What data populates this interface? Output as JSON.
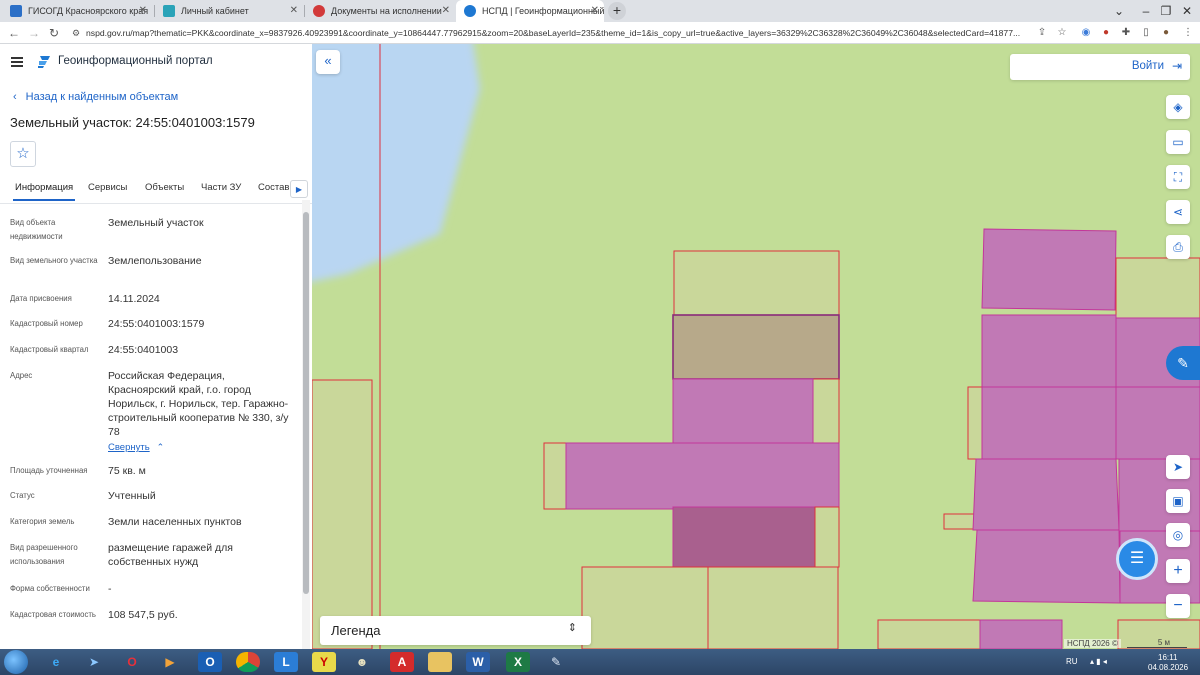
{
  "browser": {
    "tabs": [
      {
        "title": "ГИСОГД Красноярского края",
        "icon": "gisogd-favicon",
        "color": "#2b6fc7"
      },
      {
        "title": "Личный кабинет",
        "icon": "lk-favicon",
        "color": "#2aa3b8"
      },
      {
        "title": "Документы на исполнении",
        "icon": "docs-favicon",
        "color": "#d23a3a"
      },
      {
        "title": "НСПД | Геоинформационный п",
        "icon": "nspd-favicon",
        "color": "#1e78d2"
      }
    ],
    "new_tab_label": "+",
    "url": "nspd.gov.ru/map?thematic=PKK&coordinate_x=9837926.40923991&coordinate_y=10864447.77962915&zoom=20&baseLayerId=235&theme_id=1&is_copy_url=true&active_layers=36329%2C36328%2C36049%2C36048&selectedCard=41877..."
  },
  "header": {
    "portal_title": "Геоинформационный портал",
    "back_link": "Назад к найденным объектам"
  },
  "parcel": {
    "title": "Земельный участок: 24:55:0401003:1579",
    "tabs": [
      "Информация",
      "Сервисы",
      "Объекты",
      "Части ЗУ",
      "Состав"
    ],
    "active_tab": "Информация",
    "rows": [
      {
        "key": "Вид объекта недвижимости",
        "value": "Земельный участок"
      },
      {
        "key": "Вид земельного участка",
        "value": "Землепользование"
      },
      {
        "key": "Дата присвоения",
        "value": "14.11.2024"
      },
      {
        "key": "Кадастровый номер",
        "value": "24:55:0401003:1579"
      },
      {
        "key": "Кадастровый квартал",
        "value": "24:55:0401003"
      },
      {
        "key": "Адрес",
        "value": "Российская Федерация, Красноярский край, г.о. город Норильск, г. Норильск, тер. Гаражно-строительный кооператив № 330, з/у 78"
      },
      {
        "key": "Площадь уточненная",
        "value": "75 кв. м"
      },
      {
        "key": "Статус",
        "value": "Учтенный"
      },
      {
        "key": "Категория земель",
        "value": "Земли населенных пунктов"
      },
      {
        "key": "Вид разрешенного использования",
        "value": "размещение гаражей для собственных нужд"
      },
      {
        "key": "Форма собственности",
        "value": "-"
      },
      {
        "key": "Кадастровая стоимость",
        "value": "108 547,5 руб."
      }
    ],
    "collapse_label": "Свернуть"
  },
  "map": {
    "login_label": "Войти",
    "legend_label": "Легенда",
    "credit": "НСПД 2026 ©",
    "scale_label": "5 м",
    "colors": {
      "land": "#c2dd97",
      "water": "#b9d6f2",
      "parcel": "#c179b5",
      "parcel_selected": "#b7a98a",
      "outline": "#e0303c"
    }
  },
  "taskbar": {
    "language": "RU",
    "time": "16:11",
    "date": "04.08.2026"
  }
}
